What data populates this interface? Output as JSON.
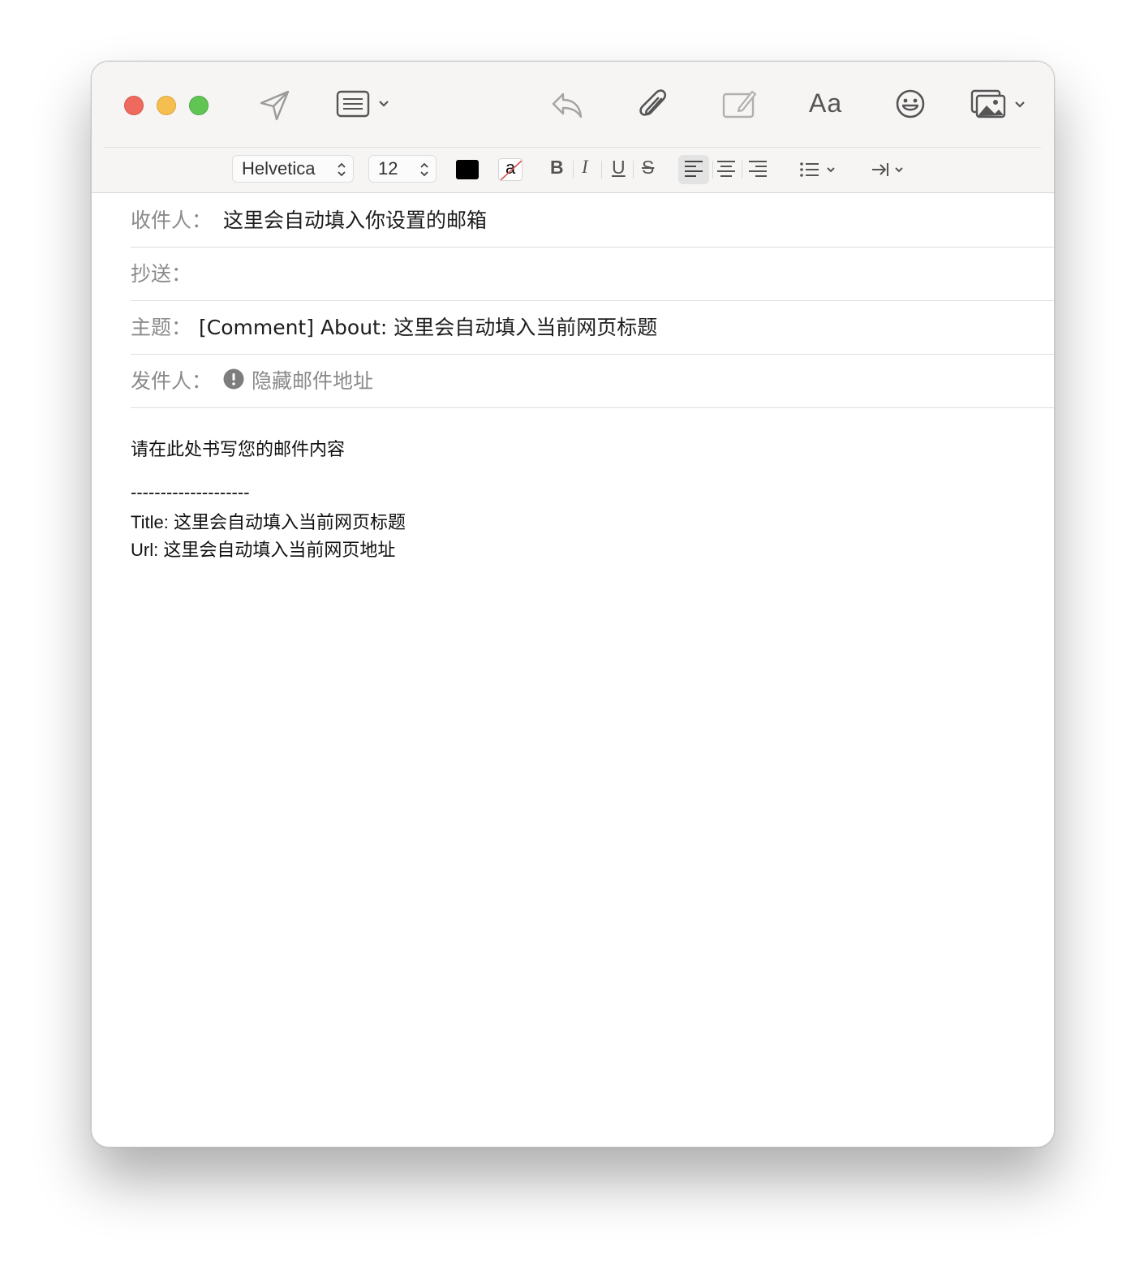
{
  "toolbar": {
    "icons": [
      "close-window",
      "minimize-window",
      "zoom-window",
      "send-icon",
      "header-fields-icon",
      "reply-icon",
      "attachment-icon",
      "markup-icon",
      "format-icon",
      "emoji-icon",
      "photo-browser-icon"
    ],
    "format_button_label": "Aa"
  },
  "format_bar": {
    "font": "Helvetica",
    "size": "12",
    "text_color": "#000000",
    "background_swatch_letter": "a",
    "bold_label": "B",
    "italic_label": "I",
    "underline_label": "U",
    "strikethrough_label": "S",
    "alignment_active": "left"
  },
  "fields": {
    "to_label": "收件人：",
    "to_value": "这里会自动填入你设置的邮箱",
    "cc_label": "抄送：",
    "subject_label": "主题：",
    "subject_value": "[Comment] About: 这里会自动填入当前网页标题",
    "from_label": "发件人：",
    "from_value": "隐藏邮件地址"
  },
  "body": {
    "line1": "请在此处书写您的邮件内容",
    "separator": "--------------------",
    "title_line": "Title: 这里会自动填入当前网页标题",
    "url_line": "Url: 这里会自动填入当前网页地址"
  },
  "colors": {
    "red_light": "#ee6a5e",
    "yellow_light": "#f5be4f",
    "green_light": "#61c554",
    "toolbar_bg": "#f6f5f4"
  }
}
